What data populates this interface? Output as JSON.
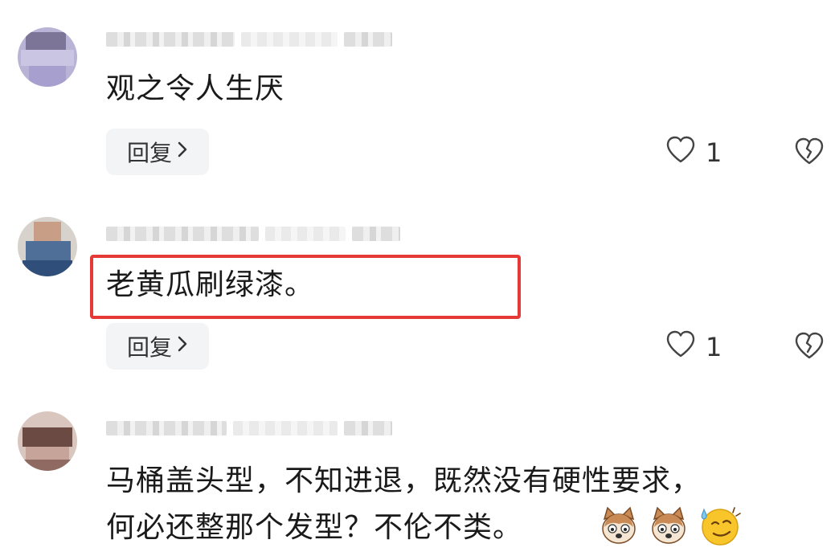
{
  "comments": [
    {
      "text": "观之令人生厌",
      "reply_label": "回复",
      "like_count": "1"
    },
    {
      "text": "老黄瓜刷绿漆。",
      "reply_label": "回复",
      "like_count": "1",
      "highlighted": true
    },
    {
      "text_line1": "马桶盖头型，不知进退，既然没有硬性要求，",
      "text_line2": "何必还整那个发型？不伦不类。",
      "emojis": [
        "dog-face-emoji",
        "dog-face-emoji",
        "sweat-smile-emoji"
      ]
    }
  ],
  "icons": {
    "like": "heart-outline-icon",
    "dislike": "broken-heart-icon",
    "reply_chevron": "chevron-right-icon"
  },
  "colors": {
    "highlight_border": "#e53935",
    "reply_button_bg": "#f3f4f6",
    "text": "#1a1a1a"
  }
}
